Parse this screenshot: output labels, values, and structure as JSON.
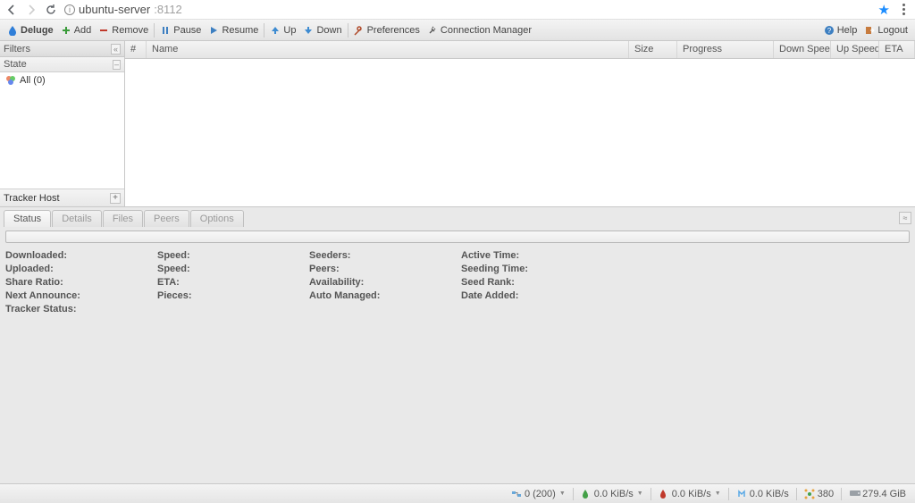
{
  "browser": {
    "url_host": "ubuntu-server",
    "url_port": ":8112"
  },
  "toolbar": {
    "app": "Deluge",
    "add": "Add",
    "remove": "Remove",
    "pause": "Pause",
    "resume": "Resume",
    "up": "Up",
    "down": "Down",
    "prefs": "Preferences",
    "connmgr": "Connection Manager",
    "help": "Help",
    "logout": "Logout"
  },
  "sidebar": {
    "filters_label": "Filters",
    "state_label": "State",
    "all_label": "All (0)",
    "tracker_label": "Tracker Host"
  },
  "grid": {
    "cols": {
      "num": "#",
      "name": "Name",
      "size": "Size",
      "progress": "Progress",
      "down": "Down Speed",
      "up": "Up Speed",
      "eta": "ETA"
    }
  },
  "tabs": {
    "status": "Status",
    "details": "Details",
    "files": "Files",
    "peers": "Peers",
    "options": "Options"
  },
  "stats": {
    "c1": {
      "downloaded": "Downloaded:",
      "uploaded": "Uploaded:",
      "share": "Share Ratio:",
      "next": "Next Announce:",
      "tracker": "Tracker Status:"
    },
    "c2": {
      "speed1": "Speed:",
      "speed2": "Speed:",
      "eta": "ETA:",
      "pieces": "Pieces:"
    },
    "c3": {
      "seeders": "Seeders:",
      "peers": "Peers:",
      "avail": "Availability:",
      "auto": "Auto Managed:"
    },
    "c4": {
      "active": "Active Time:",
      "seeding": "Seeding Time:",
      "rank": "Seed Rank:",
      "added": "Date Added:"
    }
  },
  "statusbar": {
    "conns": "0 (200)",
    "dl": "0.0 KiB/s",
    "ul": "0.0 KiB/s",
    "proto": "0.0 KiB/s",
    "dht": "380",
    "disk": "279.4 GiB"
  }
}
